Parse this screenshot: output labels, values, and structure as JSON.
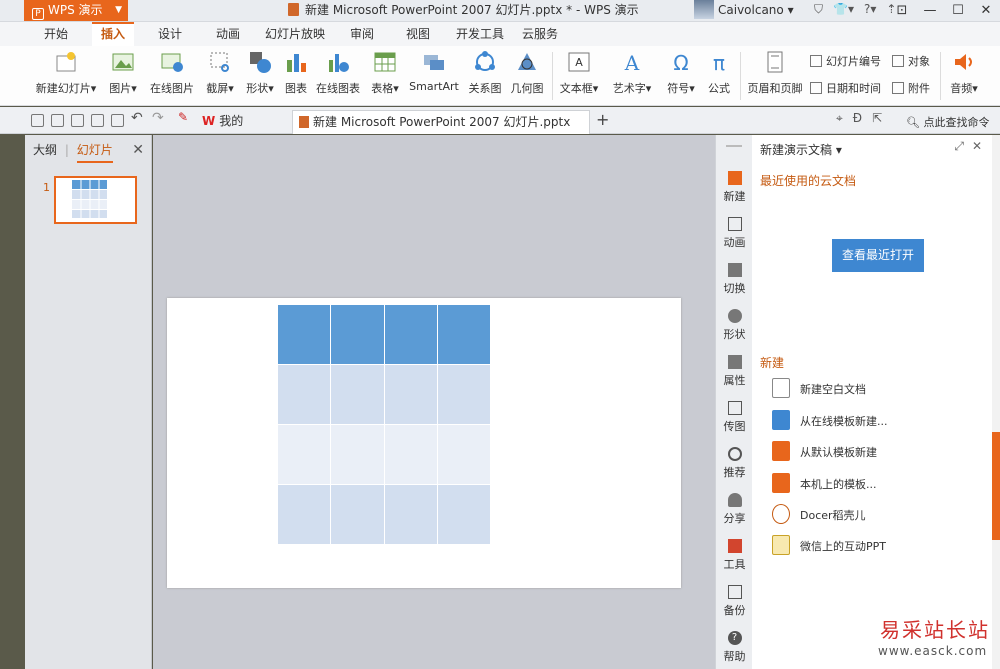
{
  "titlebar": {
    "app_name": "WPS 演示",
    "document_title": "新建 Microsoft PowerPoint 2007 幻灯片.pptx * - WPS 演示",
    "user_name": "Caivolcano"
  },
  "ribbon_tabs": [
    "开始",
    "插入",
    "设计",
    "动画",
    "幻灯片放映",
    "审阅",
    "视图",
    "开发工具",
    "云服务"
  ],
  "active_tab": "插入",
  "ribbon": {
    "new_slide": "新建幻灯片",
    "picture": "图片",
    "online_picture": "在线图片",
    "screenshot": "截屏",
    "shapes": "形状",
    "chart": "图表",
    "online_chart": "在线图表",
    "table": "表格",
    "smartart": "SmartArt",
    "relation": "关系图",
    "geometry": "几何图",
    "textbox": "文本框",
    "wordart": "艺术字",
    "symbol": "符号",
    "formula": "公式",
    "header_footer": "页眉和页脚",
    "slide_number": "幻灯片编号",
    "object": "对象",
    "date_time": "日期和时间",
    "attachment": "附件",
    "audio": "音频"
  },
  "doc_tabs": {
    "wps_tab": "我的WPS",
    "doc_tab": "新建 Microsoft PowerPoint 2007 幻灯片.pptx *",
    "find": "点此查找命令"
  },
  "left_panel": {
    "tab_outline": "大纲",
    "tab_slides": "幻灯片",
    "slide_number": "1"
  },
  "sidebar": [
    "新建",
    "动画",
    "切换",
    "形状",
    "属性",
    "传图",
    "推荐",
    "分享",
    "工具",
    "备份",
    "帮助"
  ],
  "task_pane": {
    "title": "新建演示文稿",
    "recent_heading": "最近使用的云文档",
    "recent_button": "查看最近打开",
    "new_heading": "新建",
    "items": [
      "新建空白文档",
      "从在线模板新建...",
      "从默认模板新建",
      "本机上的模板...",
      "Docer稻壳儿",
      "微信上的互动PPT"
    ]
  },
  "watermark": {
    "text": "易采站长站",
    "url": "www.easck.com"
  },
  "colors": {
    "accent": "#e8661c",
    "table_header": "#5b9bd5",
    "table_band": "#d2deef",
    "table_band_light": "#eaeff7",
    "primary_button": "#3e87d1"
  }
}
